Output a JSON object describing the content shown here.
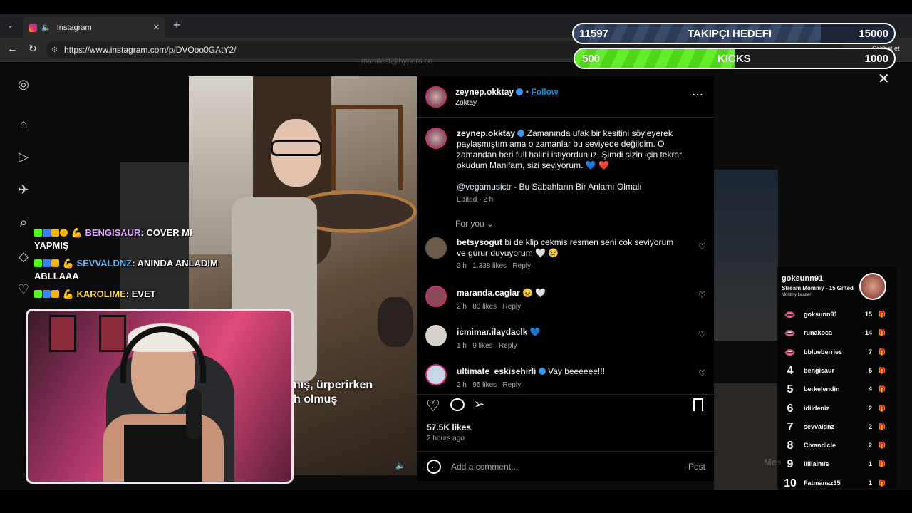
{
  "browser": {
    "tab_title": "Instagram",
    "url": "https://www.instagram.com/p/DVOoo0GAtY2/",
    "share_label": "Sohbet et"
  },
  "stream_goals": {
    "follower": {
      "current": "11597",
      "label": "TAKIPÇI HEDEFI",
      "target": "15000",
      "progress": 0.77
    },
    "kicks": {
      "current": "500",
      "label": "KICKS",
      "target": "1000",
      "progress": 0.5
    }
  },
  "background": {
    "faint_text": "- manifest@hypers.co",
    "dm_label": "Mes"
  },
  "video": {
    "subtitle_line1": "nış, ürperirken",
    "subtitle_line2": "h olmuş"
  },
  "post": {
    "author": "zeynep.okktay",
    "follow_label": "Follow",
    "author_subtitle": "Zoktay",
    "caption": "Zamanında ufak bir kesitini söyleyerek paylaşmıştım ama o zamanlar bu seviyede değildim. O zamandan beri full halini istiyordunuz. Şimdi sizin için tekrar okudum Manifam, sizi seviyorum. 💙 ❤️",
    "mention": "@vegamusictr",
    "song": " - Bu Sabahların Bir Anlamı Olmalı",
    "edited": "Edited · 2 h",
    "sort_label": "For you",
    "likes": "57.5K likes",
    "time_ago": "2 hours ago",
    "comment_placeholder": "Add a comment...",
    "post_label": "Post"
  },
  "comments": [
    {
      "user": "betsysogut",
      "text": "bi de klip cekmis resmen seni cok seviyorum ve gurur duyuyorum 🤍 😢",
      "time": "2 h",
      "likes": "1.338 likes",
      "reply": "Reply"
    },
    {
      "user": "maranda.caglar",
      "text": "😣 🤍",
      "time": "2 h",
      "likes": "80 likes",
      "reply": "Reply"
    },
    {
      "user": "icmimar.ilaydaclk",
      "text": "💙",
      "time": "1 h",
      "likes": "9 likes",
      "reply": "Reply"
    },
    {
      "user": "ultimate_eskisehirli",
      "text": "Vay beeeeee!!!",
      "time": "2 h",
      "likes": "95 likes",
      "reply": "Reply"
    }
  ],
  "chat": [
    {
      "user": "BENGISAUR",
      "color": "#e6a8ff",
      "message": "COVER MI YAPMIŞ"
    },
    {
      "user": "SEVVALDNZ",
      "color": "#58b7ff",
      "message": "ANINDA ANLADIM ABLLAAA"
    },
    {
      "user": "KAROLIME",
      "color": "#ffd84a",
      "message": "EVET"
    }
  ],
  "leaderboard": {
    "top_user": "goksunn91",
    "top_title": "Stream Mommy - 15 Gifted",
    "top_subtitle": "Monthly Leader",
    "rows": [
      {
        "rank": "",
        "name": "goksunn91",
        "count": "15",
        "medal": "gold"
      },
      {
        "rank": "",
        "name": "runakoca",
        "count": "14",
        "medal": "silver"
      },
      {
        "rank": "",
        "name": "bblueberries",
        "count": "7",
        "medal": "bronze"
      },
      {
        "rank": "4",
        "name": "bengisaur",
        "count": "5",
        "medal": ""
      },
      {
        "rank": "5",
        "name": "berkelendin",
        "count": "4",
        "medal": ""
      },
      {
        "rank": "6",
        "name": "idildeniz",
        "count": "2",
        "medal": ""
      },
      {
        "rank": "7",
        "name": "sevvaldnz",
        "count": "2",
        "medal": ""
      },
      {
        "rank": "8",
        "name": "Civandicle",
        "count": "2",
        "medal": ""
      },
      {
        "rank": "9",
        "name": "lililalmis",
        "count": "1",
        "medal": ""
      },
      {
        "rank": "10",
        "name": "Fatmanaz35",
        "count": "1",
        "medal": ""
      }
    ]
  },
  "colors": {
    "goal_blue": "#2c3a55",
    "goal_green": "#53e21b",
    "ig_blue": "#0095f6",
    "verified": "#3897f0"
  }
}
